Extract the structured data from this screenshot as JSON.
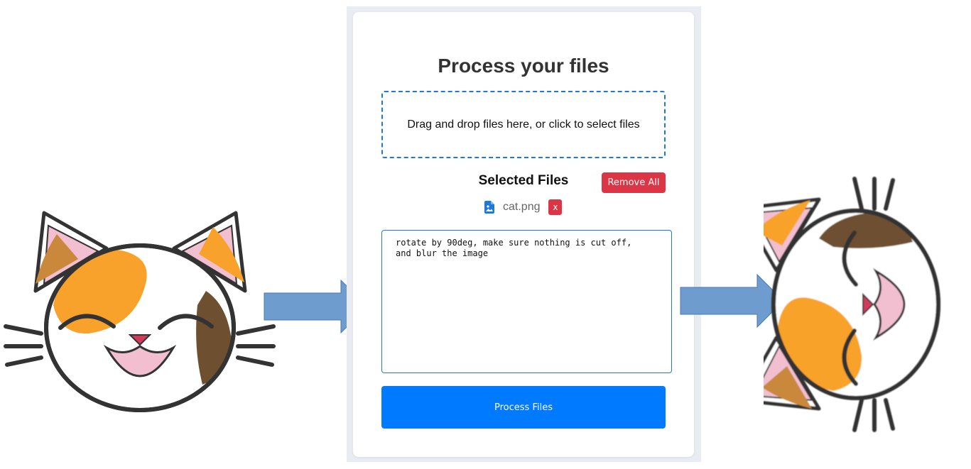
{
  "form": {
    "title": "Process your files",
    "dropzone_text": "Drag and drop files here, or click to select files",
    "selected_files_heading": "Selected Files",
    "remove_all_label": "Remove All",
    "files": [
      {
        "name": "cat.png",
        "icon": "image-file-icon",
        "remove_label": "x"
      }
    ],
    "prompt_text": "rotate by 90deg, make sure nothing is cut off,\nand blur the image",
    "process_label": "Process Files"
  },
  "illustrations": {
    "input": "cat-face-illustration",
    "output": "rotated-blurred-cat-illustration",
    "arrows": "right-arrow-icon"
  },
  "colors": {
    "accent": "#007bff",
    "danger": "#dc3545",
    "arrow": "#6e9ccf",
    "cat_orange": "#f8a22c",
    "cat_brown": "#6e5030",
    "cat_pink": "#f2bfd0"
  }
}
